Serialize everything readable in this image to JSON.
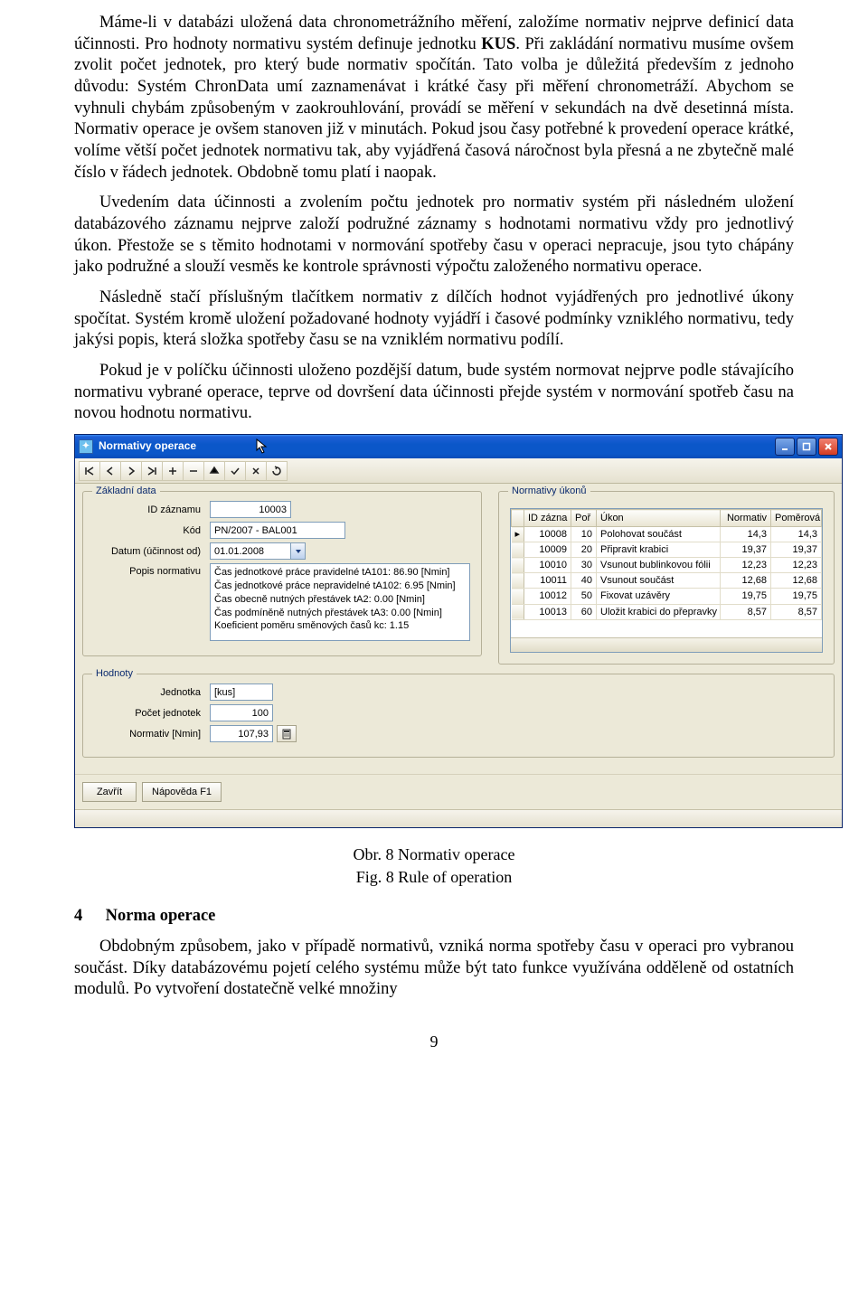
{
  "paragraphs": {
    "p1_a": "Máme-li v databázi uložená data chronometrážního měření, založíme normativ nejprve definicí data účinnosti. Pro hodnoty normativu systém definuje jednotku ",
    "p1_b": "KUS",
    "p1_c": ". Při zakládání normativu musíme ovšem zvolit počet jednotek, pro který bude normativ spočítán. Tato volba je důležitá především z jednoho důvodu: Systém ChronData umí zaznamenávat i krátké časy při měření chronometráží. Abychom se vyhnuli chybám způsobeným v zaokrouhlování, provádí se měření v sekundách na dvě desetinná místa. Normativ operace je ovšem stanoven již v minutách. Pokud jsou časy potřebné k provedení operace krátké, volíme větší počet jednotek normativu tak, aby vyjádřená časová náročnost byla přesná a ne zbytečně malé číslo v řádech jednotek. Obdobně tomu platí i naopak.",
    "p2": "Uvedením data účinnosti a zvolením počtu jednotek pro normativ systém při následném uložení databázového záznamu nejprve založí podružné záznamy s hodnotami normativu vždy pro jednotlivý úkon. Přestože se s těmito hodnotami v normování spotřeby času v operaci nepracuje, jsou tyto chápány jako podružné a slouží vesměs ke kontrole správnosti výpočtu založeného normativu operace.",
    "p3": "Následně stačí příslušným tlačítkem normativ z dílčích hodnot vyjádřených pro jednotlivé úkony spočítat. Systém kromě uložení požadované hodnoty vyjádří i časové podmínky vzniklého normativu, tedy jakýsi popis, která složka spotřeby času se na vzniklém normativu podílí.",
    "p4": "Pokud je v políčku účinnosti uloženo pozdější datum, bude systém normovat nejprve podle stávajícího normativu vybrané operace, teprve od dovršení data účinnosti přejde systém v normování spotřeb času na novou hodnotu normativu."
  },
  "window_title": "Normativy operace",
  "groups": {
    "zakladni": "Základní data",
    "ukonu": "Normativy úkonů",
    "hodnoty": "Hodnoty"
  },
  "labels": {
    "id": "ID záznamu",
    "kod": "Kód",
    "datum": "Datum (účinnost od)",
    "popis": "Popis normativu",
    "jednotka": "Jednotka",
    "pocet": "Počet jednotek",
    "normativ": "Normativ [Nmin]"
  },
  "values": {
    "id": "10003",
    "kod": "PN/2007 - BAL001",
    "datum": "01.01.2008",
    "popis": "Čas jednotkové práce pravidelné tA101: 86.90 [Nmin]\nČas jednotkové práce nepravidelné tA102: 6.95 [Nmin]\nČas obecně nutných přestávek tA2: 0.00 [Nmin]\nČas podmíněně nutných přestávek tA3: 0.00 [Nmin]\nKoeficient poměru směnových časů kc: 1.15",
    "jednotka": "[kus]",
    "pocet": "100",
    "normativ": "107,93"
  },
  "grid": {
    "headers": {
      "id": "ID zázna",
      "por": "Poř",
      "ukon": "Úkon",
      "normativ": "Normativ",
      "pomerova": "Poměrová"
    },
    "rows": [
      {
        "id": "10008",
        "por": "10",
        "ukon": "Polohovat součást",
        "norm": "14,3",
        "pom": "14,3"
      },
      {
        "id": "10009",
        "por": "20",
        "ukon": "Připravit krabici",
        "norm": "19,37",
        "pom": "19,37"
      },
      {
        "id": "10010",
        "por": "30",
        "ukon": "Vsunout bublinkovou fólii",
        "norm": "12,23",
        "pom": "12,23"
      },
      {
        "id": "10011",
        "por": "40",
        "ukon": "Vsunout součást",
        "norm": "12,68",
        "pom": "12,68"
      },
      {
        "id": "10012",
        "por": "50",
        "ukon": "Fixovat uzávěry",
        "norm": "19,75",
        "pom": "19,75"
      },
      {
        "id": "10013",
        "por": "60",
        "ukon": "Uložit krabici do přepravky",
        "norm": "8,57",
        "pom": "8,57"
      }
    ]
  },
  "buttons": {
    "zavrit": "Zavřít",
    "napoveda": "Nápověda F1"
  },
  "caption1": "Obr. 8 Normativ operace",
  "caption2": "Fig. 8 Rule of operation",
  "section": {
    "num": "4",
    "title": "Norma operace"
  },
  "p5": "Obdobným způsobem, jako v případě normativů, vzniká norma spotřeby času v operaci pro vybranou součást. Díky databázovému pojetí celého systému může být tato funkce využívána odděleně od ostatních modulů. Po vytvoření dostatečně velké množiny",
  "page_number": "9"
}
